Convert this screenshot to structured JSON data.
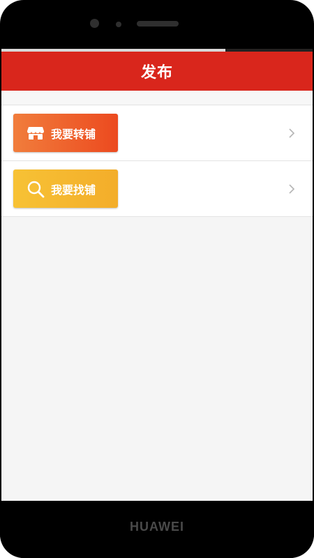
{
  "device": {
    "brand": "HUAWEI"
  },
  "header": {
    "title": "发布"
  },
  "menu": {
    "items": [
      {
        "label": "我要转铺",
        "icon": "shop-icon",
        "color": "#ec4a1f"
      },
      {
        "label": "我要找铺",
        "icon": "search-icon",
        "color": "#f3ad2a"
      }
    ]
  },
  "colors": {
    "header_bg": "#d9261c",
    "background": "#f5f5f5"
  }
}
